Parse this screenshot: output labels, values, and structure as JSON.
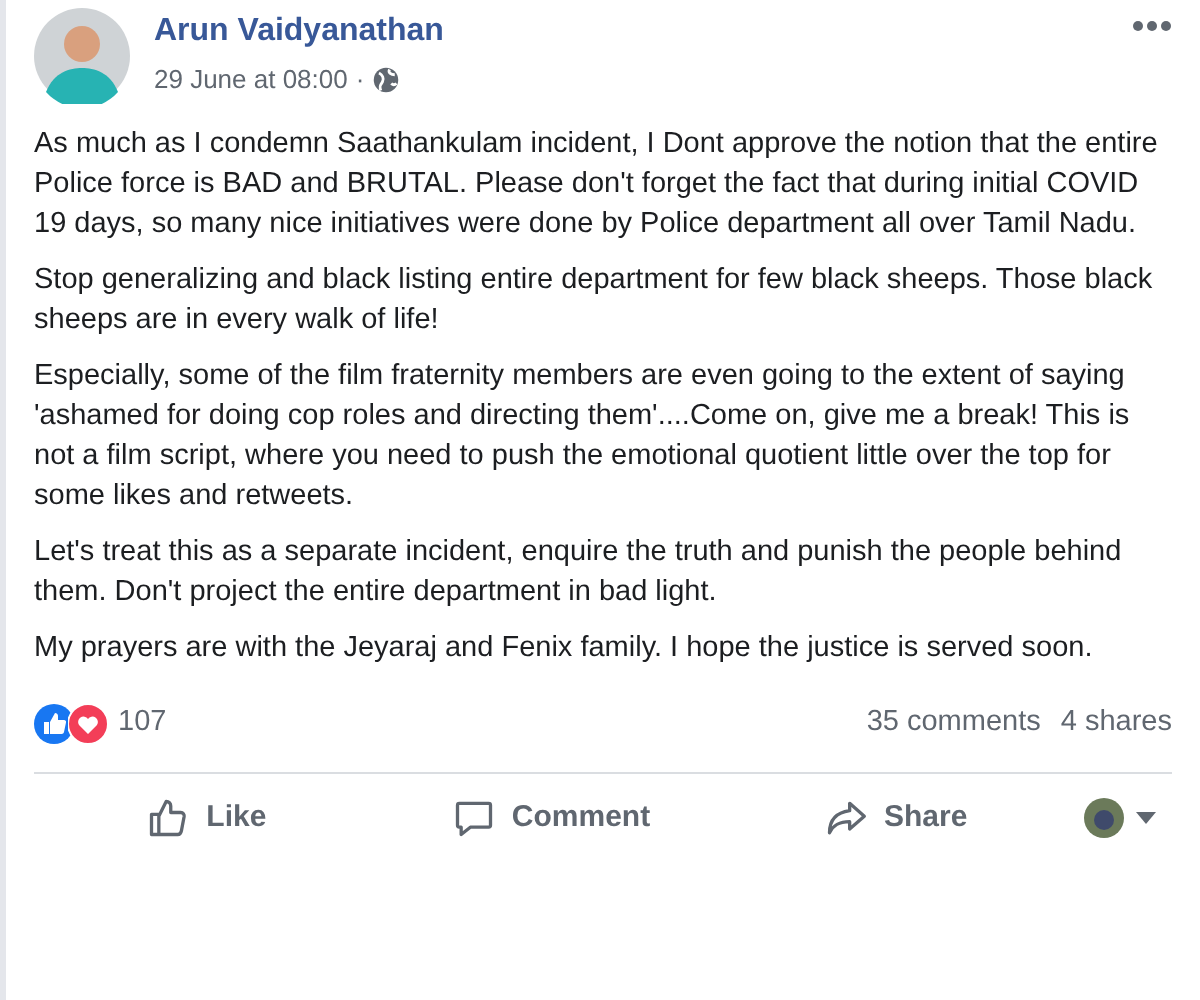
{
  "post": {
    "author": "Arun Vaidyanathan",
    "timestamp": "29 June at 08:00",
    "separator": "·",
    "paragraphs": [
      "As much as I condemn Saathankulam incident, I Dont approve the notion that the entire Police force is BAD and BRUTAL. Please don't forget the fact that during initial COVID 19 days, so many nice initiatives were done by Police department all over Tamil Nadu.",
      "Stop generalizing and black listing entire department for few black sheeps. Those black sheeps are in every walk of life!",
      "Especially, some of the film fraternity members are even going to the extent of saying 'ashamed for doing cop roles and directing them'....Come on, give me a break! This is not a film script, where you need to push the emotional quotient little over the top for some likes and retweets.",
      "Let's treat this as a separate incident, enquire the truth and punish the people behind them. Don't project the entire department in bad light.",
      "My prayers are with the Jeyaraj and Fenix family. I hope the justice is served soon."
    ],
    "reaction_count": "107",
    "comments": "35 comments",
    "shares": "4 shares"
  },
  "actions": [
    {
      "kind": "like",
      "label": "Like"
    },
    {
      "kind": "comment",
      "label": "Comment"
    },
    {
      "kind": "share",
      "label": "Share"
    }
  ]
}
